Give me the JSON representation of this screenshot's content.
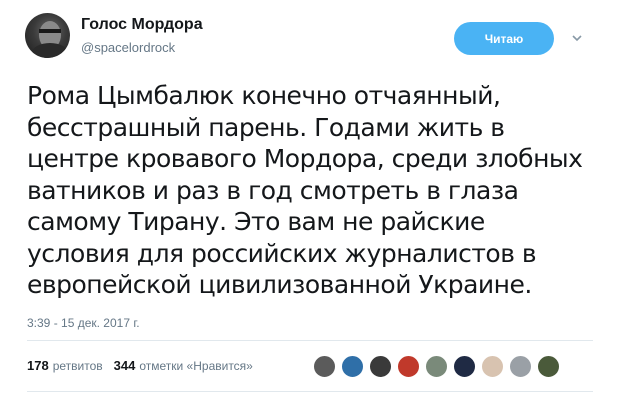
{
  "user": {
    "name": "Голос Мордора",
    "handle": "@spacelordrock"
  },
  "follow_button": {
    "label": "Читаю"
  },
  "tweet": {
    "text": "Рома Цымбалюк конечно отчаянный,\nбесстрашный парень. Годами жить в\nцентре кровавого Мордора, среди злобных\nватников и раз в год смотреть в глаза\nсамому Тирану. Это вам не райские\nусловия для российских журналистов в\nевропейской цивилизованной Украине.",
    "timestamp": "3:39 - 15 дек. 2017 г."
  },
  "stats": {
    "retweets_count": "178",
    "retweets_label": "ретвитов",
    "likes_count": "344",
    "likes_label": "отметки «Нравится»"
  },
  "likers": [
    {
      "name": "liker-avatar-1",
      "color": "#5b5b5b"
    },
    {
      "name": "liker-avatar-2",
      "color": "#2f6fa8"
    },
    {
      "name": "liker-avatar-3",
      "color": "#3a3a3a"
    },
    {
      "name": "liker-avatar-4",
      "color": "#c0392b"
    },
    {
      "name": "liker-avatar-5",
      "color": "#7a8a7a"
    },
    {
      "name": "liker-avatar-6",
      "color": "#1f2a44"
    },
    {
      "name": "liker-avatar-7",
      "color": "#d8c3b0"
    },
    {
      "name": "liker-avatar-8",
      "color": "#9aa0a6"
    },
    {
      "name": "liker-avatar-9",
      "color": "#4a5a3a"
    }
  ],
  "colors": {
    "follow_button_bg": "#4ab3f4",
    "secondary_text": "#657786",
    "primary_text": "#14171a"
  }
}
